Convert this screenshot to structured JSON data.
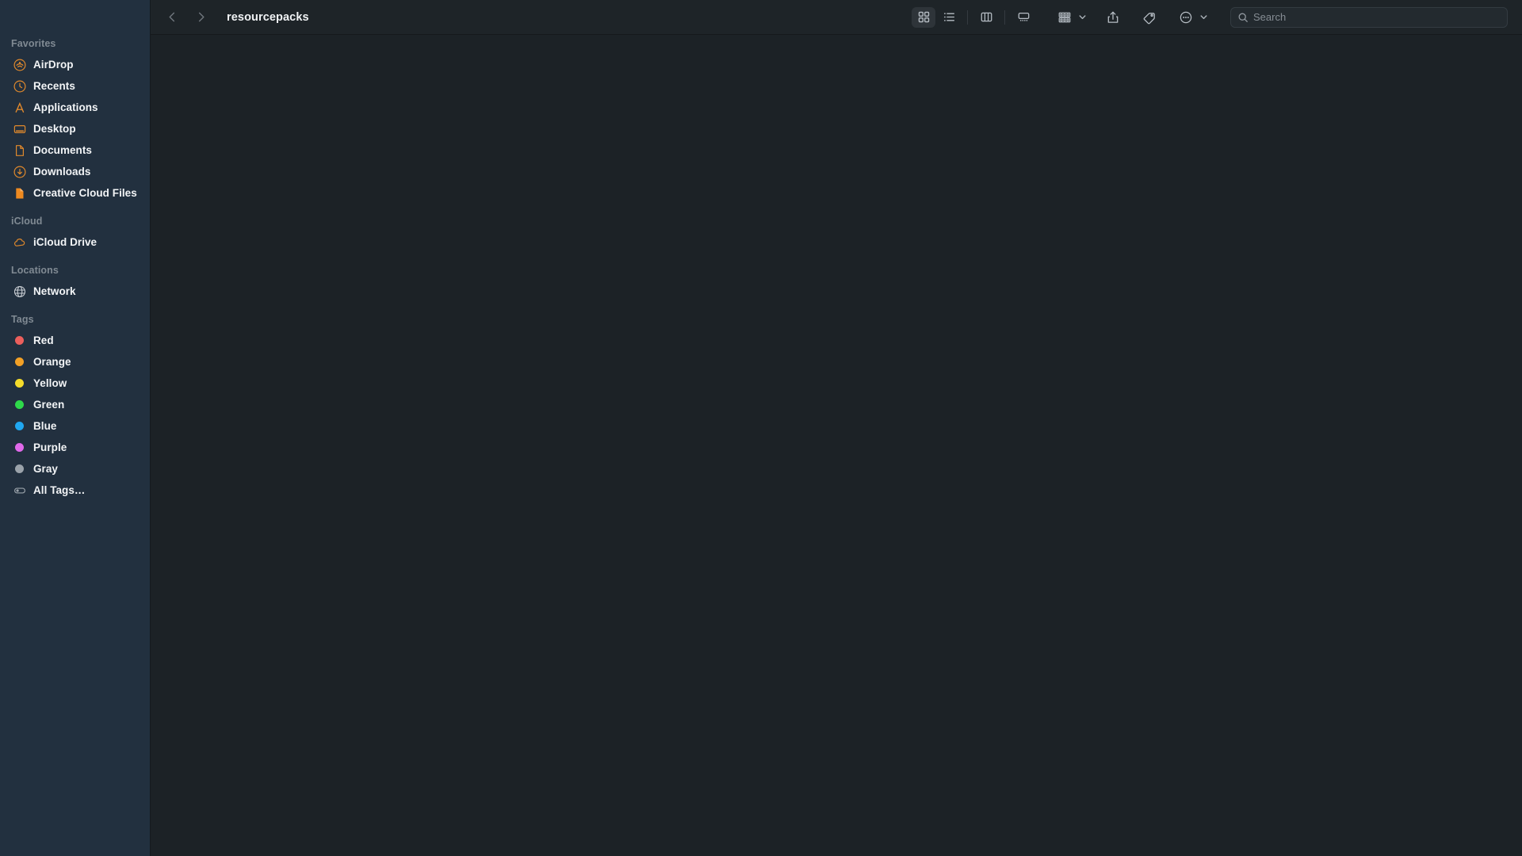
{
  "window": {
    "title": "resourcepacks"
  },
  "toolbar": {
    "back_label": "Back",
    "forward_label": "Forward",
    "view_buttons": [
      {
        "name": "icon-view",
        "label": "Icon View",
        "selected": true
      },
      {
        "name": "list-view",
        "label": "List View",
        "selected": false
      },
      {
        "name": "column-view",
        "label": "Column View",
        "selected": false
      },
      {
        "name": "gallery-view",
        "label": "Gallery View",
        "selected": false
      }
    ],
    "group_label": "Group",
    "share_label": "Share",
    "tag_label": "Tag",
    "more_label": "More"
  },
  "search": {
    "placeholder": "Search",
    "value": ""
  },
  "sidebar": {
    "sections": [
      {
        "header": "Favorites",
        "items": [
          {
            "label": "AirDrop",
            "icon": "airdrop-icon",
            "color": "#e0892c"
          },
          {
            "label": "Recents",
            "icon": "clock-icon",
            "color": "#e0892c"
          },
          {
            "label": "Applications",
            "icon": "applications-icon",
            "color": "#e0892c"
          },
          {
            "label": "Desktop",
            "icon": "desktop-icon",
            "color": "#e0892c"
          },
          {
            "label": "Documents",
            "icon": "document-icon",
            "color": "#e0892c"
          },
          {
            "label": "Downloads",
            "icon": "downloads-icon",
            "color": "#e0892c"
          },
          {
            "label": "Creative Cloud Files",
            "icon": "creative-cloud-file-icon",
            "color": "#ef8a20"
          }
        ]
      },
      {
        "header": "iCloud",
        "items": [
          {
            "label": "iCloud Drive",
            "icon": "cloud-icon",
            "color": "#e0892c"
          }
        ]
      },
      {
        "header": "Locations",
        "items": [
          {
            "label": "Network",
            "icon": "globe-icon",
            "color": "#c9ced4"
          }
        ]
      },
      {
        "header": "Tags",
        "items": [
          {
            "label": "Red",
            "icon": "tag-dot-red",
            "color": "#ec5f5c"
          },
          {
            "label": "Orange",
            "icon": "tag-dot-orange",
            "color": "#f3a126"
          },
          {
            "label": "Yellow",
            "icon": "tag-dot-yellow",
            "color": "#f5dc2b"
          },
          {
            "label": "Green",
            "icon": "tag-dot-green",
            "color": "#2ed94a"
          },
          {
            "label": "Blue",
            "icon": "tag-dot-blue",
            "color": "#20a7f0"
          },
          {
            "label": "Purple",
            "icon": "tag-dot-purple",
            "color": "#e069ea"
          },
          {
            "label": "Gray",
            "icon": "tag-dot-gray",
            "color": "#9aa2aa"
          },
          {
            "label": "All Tags…",
            "icon": "all-tags-icon",
            "color": "#9aa2aa"
          }
        ]
      }
    ]
  },
  "content": {
    "items": [],
    "empty": true
  },
  "colors": {
    "sidebar_bg": "#22303f",
    "content_bg": "#1c2226",
    "toolbar_bg": "#1e2428",
    "accent_orange": "#e0892c",
    "label_text": "#f2f4f6",
    "header_text": "#808a93"
  }
}
